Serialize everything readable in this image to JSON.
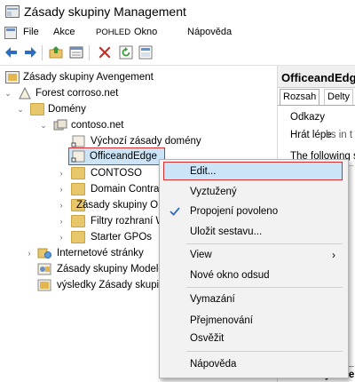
{
  "window": {
    "title": "Zásady skupiny Management"
  },
  "menubar": {
    "items": [
      "File",
      "Akce",
      "POHLED",
      "Okno",
      "Nápověda"
    ]
  },
  "toolbar": {
    "icons": [
      "back-icon",
      "forward-icon",
      "up-folder-icon",
      "properties-icon",
      "delete-icon",
      "refresh-icon",
      "help-icon"
    ]
  },
  "tree": {
    "root": "Zásady skupiny Avengement",
    "forest": "Forest corroso.net",
    "domains": "Domény",
    "domain": "contoso.net",
    "default_policy": "Výchozí zásady domény",
    "selected_gpo": "OfficeandEdge",
    "ou_contoso": "CONTOSO",
    "domain_controllers": "Domain Contra",
    "gpo_container": "Zásady skupiny O",
    "wmi_filters": "Filtry rozhraní WMI",
    "starter_gpos": "Starter GPOs",
    "internet_sites": "Internetové stránky",
    "modeling": "Zásady skupiny Modelování",
    "results": "výsledky Zásady skupiny"
  },
  "right_pane": {
    "title": "OfficeandEdge",
    "tabs": [
      "Rozsah",
      "Delty"
    ],
    "links_label": "Odkazy",
    "play_label": "Hrát lépe",
    "play_overlay": "ks in t",
    "following_text": "The following si",
    "security_label": "Security Filte"
  },
  "context_menu": {
    "items": [
      {
        "label": "Edit...",
        "highlighted": true
      },
      {
        "label": "Vyztužený"
      },
      {
        "label": "Propojení povoleno",
        "checked": true
      },
      {
        "label": "Uložit sestavu..."
      },
      {
        "label": "View",
        "submenu": true
      },
      {
        "label": "Nové okno odsud"
      },
      {
        "label": "Vymazání"
      },
      {
        "label": "Přejmenování"
      },
      {
        "label": "Osvěžit"
      },
      {
        "label": "Nápověda"
      }
    ]
  },
  "colors": {
    "highlight_border": "#d32f2f",
    "menu_bg": "#f2f2f2",
    "selection_bg": "#cce4f7"
  }
}
